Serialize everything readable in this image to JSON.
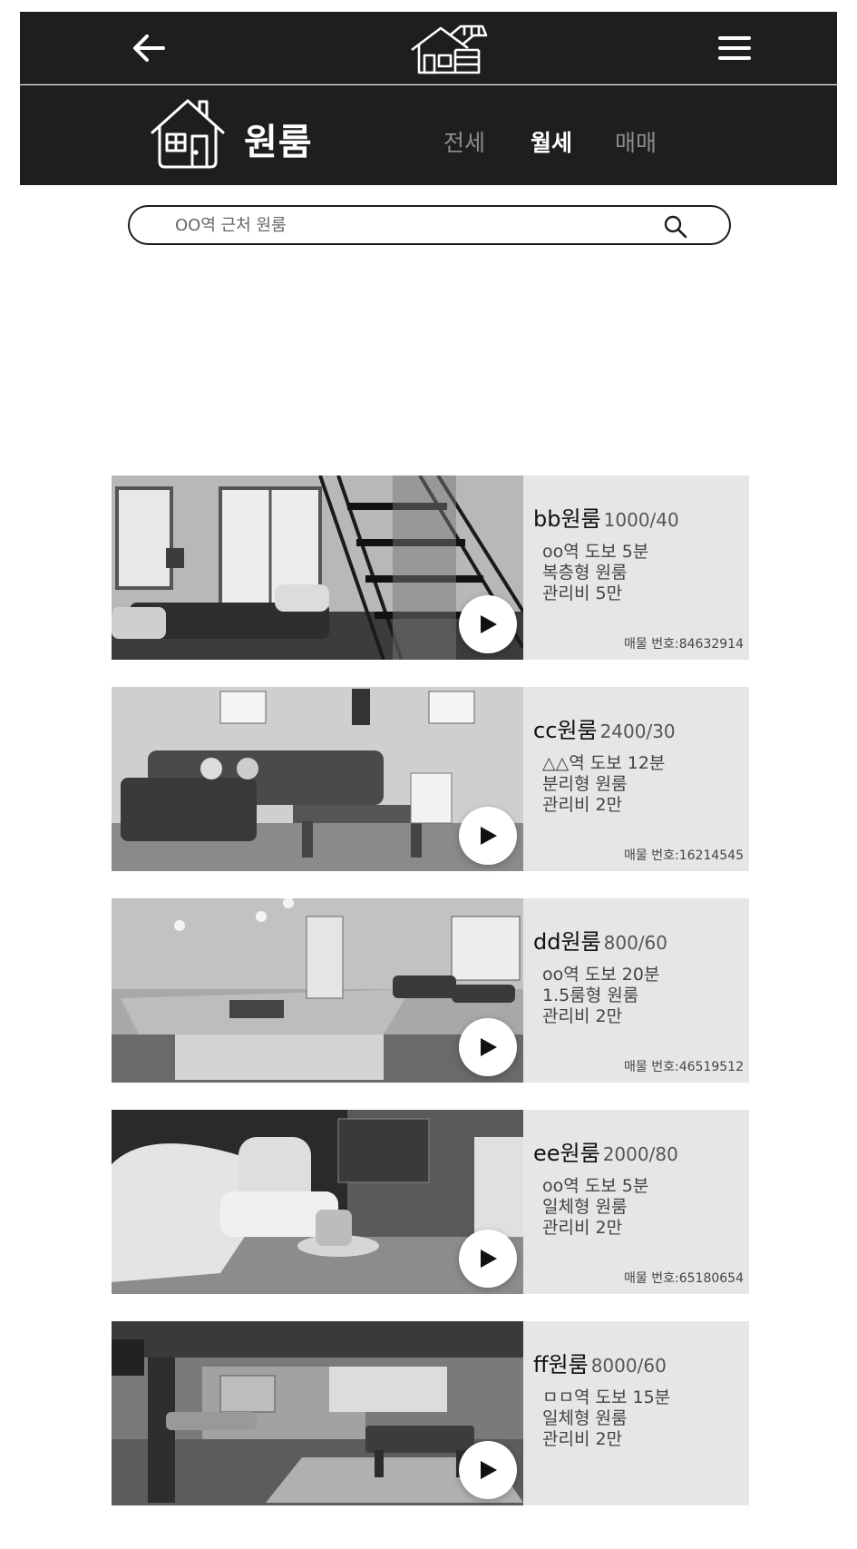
{
  "header": {
    "back_icon": "arrow-left-icon",
    "logo_icon": "house-logo-icon",
    "menu_icon": "hamburger-menu-icon"
  },
  "category": {
    "icon": "house-icon",
    "title": "원룸",
    "tabs": [
      {
        "label": "전세",
        "active": false
      },
      {
        "label": "월세",
        "active": true
      },
      {
        "label": "매매",
        "active": false
      }
    ]
  },
  "search": {
    "placeholder": "OO역 근처 원룸",
    "icon": "search-icon"
  },
  "listings": [
    {
      "name": "bb원룸",
      "price": "1000/40",
      "details": [
        "oo역 도보 5분",
        "복층형 원룸",
        "관리비 5만"
      ],
      "listing_no": "매물 번호:84632914"
    },
    {
      "name": "cc원룸",
      "price": "2400/30",
      "details": [
        "△△역 도보 12분",
        "분리형 원룸",
        "관리비 2만"
      ],
      "listing_no": "매물 번호:16214545"
    },
    {
      "name": "dd원룸",
      "price": "800/60",
      "details": [
        "oo역 도보 20분",
        "1.5룸형 원룸",
        "관리비 2만"
      ],
      "listing_no": "매물 번호:46519512"
    },
    {
      "name": "ee원룸",
      "price": "2000/80",
      "details": [
        "oo역 도보 5분",
        "일체형 원룸",
        "관리비 2만"
      ],
      "listing_no": "매물 번호:65180654"
    },
    {
      "name": "ff원룸",
      "price": "8000/60",
      "details": [
        "ㅁㅁ역 도보 15분",
        "일체형 원룸",
        "관리비 2만"
      ],
      "listing_no": ""
    }
  ],
  "colors": {
    "header_bg": "#1e1e1e",
    "card_bg": "#e6e6e6",
    "tab_inactive": "#8c8c8c",
    "tab_active": "#ffffff"
  }
}
